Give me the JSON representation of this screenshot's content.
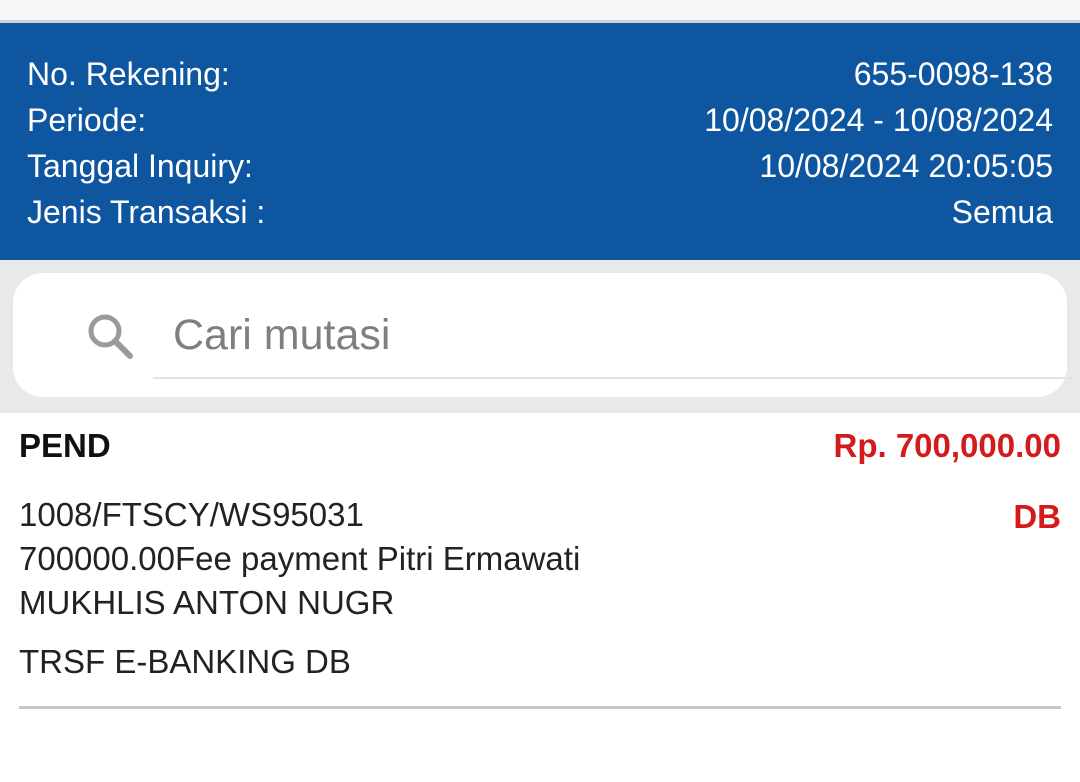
{
  "header": {
    "account_label": "No. Rekening:",
    "account_value": "655-0098-138",
    "period_label": "Periode:",
    "period_value": "10/08/2024 - 10/08/2024",
    "inquiry_label": "Tanggal Inquiry:",
    "inquiry_value": "10/08/2024 20:05:05",
    "type_label": "Jenis Transaksi :",
    "type_value": "Semua"
  },
  "search": {
    "placeholder": "Cari mutasi",
    "icon": "search-icon"
  },
  "transactions": [
    {
      "status": "PEND",
      "amount": "Rp. 700,000.00",
      "type": "DB",
      "desc_line1": "1008/FTSCY/WS95031",
      "desc_line2": "700000.00Fee payment Pitri Ermawati",
      "desc_line3": "MUKHLIS ANTON NUGR",
      "category": "TRSF E-BANKING DB"
    }
  ],
  "colors": {
    "header_bg": "#0e56a0",
    "debit_red": "#d41b1b",
    "search_bg": "#e8e9eb"
  }
}
